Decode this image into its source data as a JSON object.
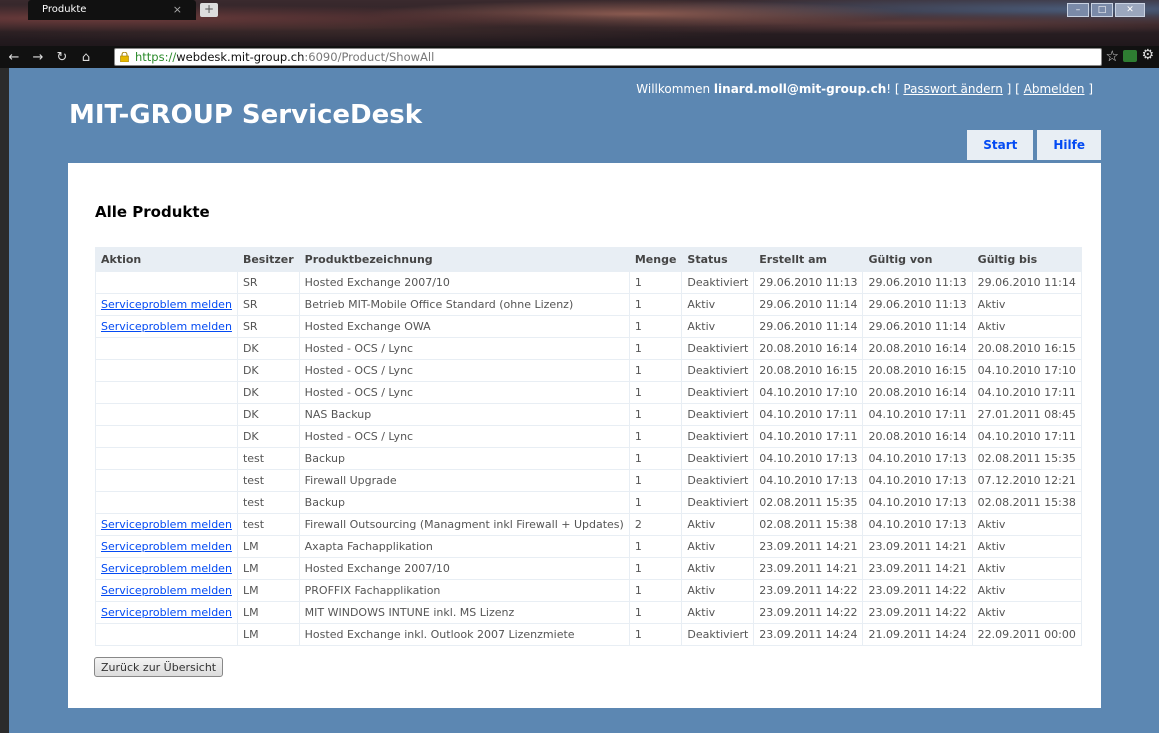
{
  "browser": {
    "tab_title": "Produkte",
    "tab_close": "×",
    "new_tab": "+",
    "url_scheme": "https://",
    "url_host": "webdesk.mit-group.ch",
    "url_rest": ":6090/Product/ShowAll"
  },
  "header": {
    "welcome_prefix": "Willkommen ",
    "user": "linard.moll@mit-group.ch",
    "welcome_suffix": "! [ ",
    "change_password": "Passwort ändern",
    "sep": " ] [ ",
    "logout": "Abmelden",
    "end": " ]",
    "title": "MIT-GROUP ServiceDesk"
  },
  "menu": {
    "start": "Start",
    "help": "Hilfe"
  },
  "page": {
    "heading": "Alle Produkte",
    "back_button": "Zurück zur Übersicht"
  },
  "table": {
    "columns": [
      "Aktion",
      "Besitzer",
      "Produktbezeichnung",
      "Menge",
      "Status",
      "Erstellt am",
      "Gültig von",
      "Gültig bis"
    ],
    "rows": [
      {
        "action": "",
        "owner": "SR",
        "product": "Hosted Exchange 2007/10",
        "qty": "1",
        "status": "Deaktiviert",
        "created": "29.06.2010 11:13",
        "valid_from": "29.06.2010 11:13",
        "valid_to": "29.06.2010 11:14"
      },
      {
        "action": "Serviceproblem melden",
        "owner": "SR",
        "product": "Betrieb MIT-Mobile Office Standard (ohne Lizenz)",
        "qty": "1",
        "status": "Aktiv",
        "created": "29.06.2010 11:14",
        "valid_from": "29.06.2010 11:13",
        "valid_to": "Aktiv"
      },
      {
        "action": "Serviceproblem melden",
        "owner": "SR",
        "product": "Hosted Exchange OWA",
        "qty": "1",
        "status": "Aktiv",
        "created": "29.06.2010 11:14",
        "valid_from": "29.06.2010 11:14",
        "valid_to": "Aktiv"
      },
      {
        "action": "",
        "owner": "DK",
        "product": "Hosted - OCS / Lync",
        "qty": "1",
        "status": "Deaktiviert",
        "created": "20.08.2010 16:14",
        "valid_from": "20.08.2010 16:14",
        "valid_to": "20.08.2010 16:15"
      },
      {
        "action": "",
        "owner": "DK",
        "product": "Hosted - OCS / Lync",
        "qty": "1",
        "status": "Deaktiviert",
        "created": "20.08.2010 16:15",
        "valid_from": "20.08.2010 16:15",
        "valid_to": "04.10.2010 17:10"
      },
      {
        "action": "",
        "owner": "DK",
        "product": "Hosted - OCS / Lync",
        "qty": "1",
        "status": "Deaktiviert",
        "created": "04.10.2010 17:10",
        "valid_from": "20.08.2010 16:14",
        "valid_to": "04.10.2010 17:11"
      },
      {
        "action": "",
        "owner": "DK",
        "product": "NAS Backup",
        "qty": "1",
        "status": "Deaktiviert",
        "created": "04.10.2010 17:11",
        "valid_from": "04.10.2010 17:11",
        "valid_to": "27.01.2011 08:45"
      },
      {
        "action": "",
        "owner": "DK",
        "product": "Hosted - OCS / Lync",
        "qty": "1",
        "status": "Deaktiviert",
        "created": "04.10.2010 17:11",
        "valid_from": "20.08.2010 16:14",
        "valid_to": "04.10.2010 17:11"
      },
      {
        "action": "",
        "owner": "test",
        "product": "Backup",
        "qty": "1",
        "status": "Deaktiviert",
        "created": "04.10.2010 17:13",
        "valid_from": "04.10.2010 17:13",
        "valid_to": "02.08.2011 15:35"
      },
      {
        "action": "",
        "owner": "test",
        "product": "Firewall Upgrade",
        "qty": "1",
        "status": "Deaktiviert",
        "created": "04.10.2010 17:13",
        "valid_from": "04.10.2010 17:13",
        "valid_to": "07.12.2010 12:21"
      },
      {
        "action": "",
        "owner": "test",
        "product": "Backup",
        "qty": "1",
        "status": "Deaktiviert",
        "created": "02.08.2011 15:35",
        "valid_from": "04.10.2010 17:13",
        "valid_to": "02.08.2011 15:38"
      },
      {
        "action": "Serviceproblem melden",
        "owner": "test",
        "product": "Firewall Outsourcing (Managment inkl Firewall + Updates)",
        "qty": "2",
        "status": "Aktiv",
        "created": "02.08.2011 15:38",
        "valid_from": "04.10.2010 17:13",
        "valid_to": "Aktiv"
      },
      {
        "action": "Serviceproblem melden",
        "owner": "LM",
        "product": "Axapta Fachapplikation",
        "qty": "1",
        "status": "Aktiv",
        "created": "23.09.2011 14:21",
        "valid_from": "23.09.2011 14:21",
        "valid_to": "Aktiv"
      },
      {
        "action": "Serviceproblem melden",
        "owner": "LM",
        "product": "Hosted Exchange 2007/10",
        "qty": "1",
        "status": "Aktiv",
        "created": "23.09.2011 14:21",
        "valid_from": "23.09.2011 14:21",
        "valid_to": "Aktiv"
      },
      {
        "action": "Serviceproblem melden",
        "owner": "LM",
        "product": "PROFFIX Fachapplikation",
        "qty": "1",
        "status": "Aktiv",
        "created": "23.09.2011 14:22",
        "valid_from": "23.09.2011 14:22",
        "valid_to": "Aktiv"
      },
      {
        "action": "Serviceproblem melden",
        "owner": "LM",
        "product": "MIT WINDOWS INTUNE inkl. MS Lizenz",
        "qty": "1",
        "status": "Aktiv",
        "created": "23.09.2011 14:22",
        "valid_from": "23.09.2011 14:22",
        "valid_to": "Aktiv"
      },
      {
        "action": "",
        "owner": "LM",
        "product": "Hosted Exchange inkl. Outlook 2007 Lizenzmiete",
        "qty": "1",
        "status": "Deaktiviert",
        "created": "23.09.2011 14:24",
        "valid_from": "21.09.2011 14:24",
        "valid_to": "22.09.2011 00:00"
      }
    ]
  }
}
